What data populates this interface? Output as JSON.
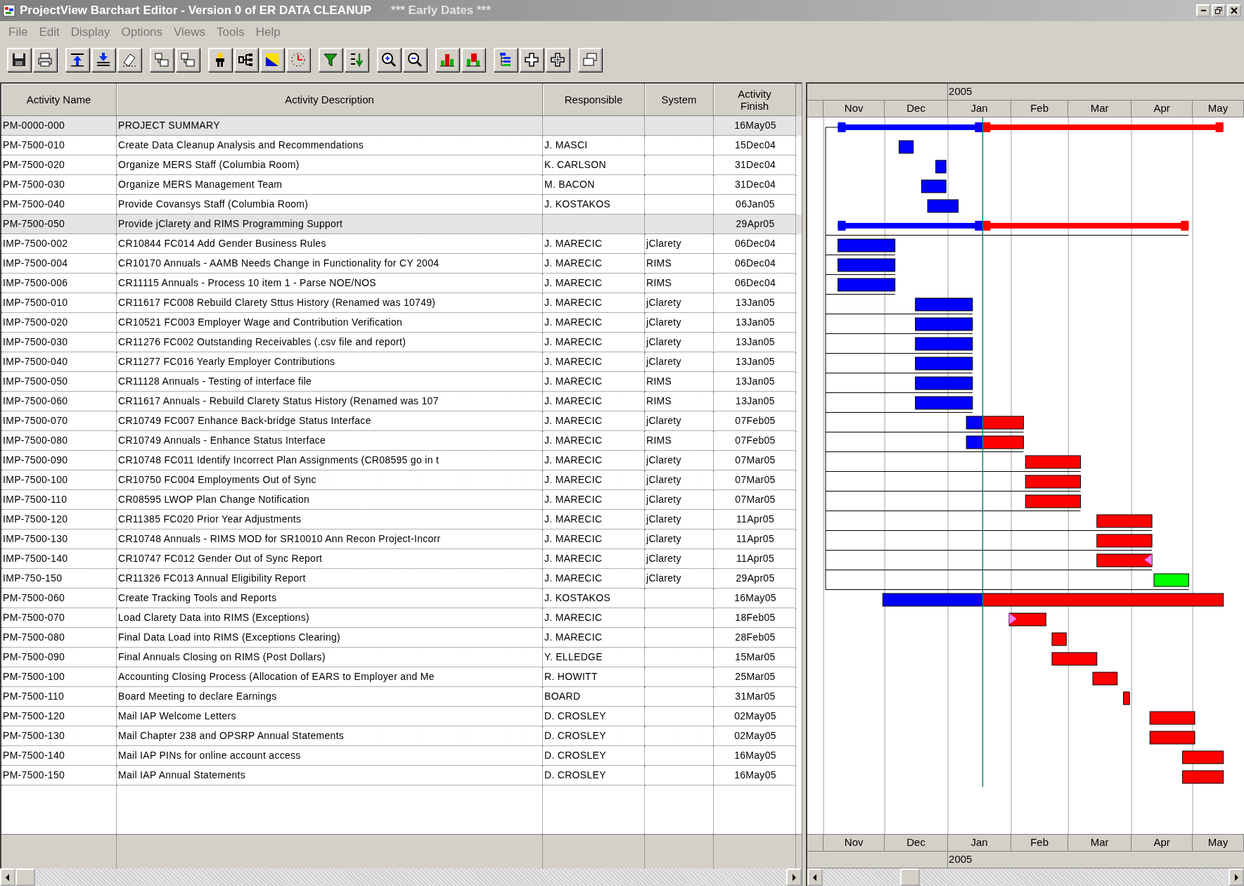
{
  "window": {
    "title": "ProjectView Barchart Editor - Version 0 of ER DATA CLEANUP",
    "subtitle": "*** Early Dates ***"
  },
  "menu": [
    "File",
    "Edit",
    "Display",
    "Options",
    "Views",
    "Tools",
    "Help"
  ],
  "table": {
    "columns": [
      "Activity Name",
      "Activity Description",
      "Responsible",
      "System",
      "Activity Finish"
    ],
    "rows": [
      {
        "name": "PM-0000-000",
        "description": "PROJECT SUMMARY",
        "finish": "16May05",
        "kind": "summary"
      },
      {
        "name": "PM-7500-010",
        "description": "Create Data Cleanup Analysis and Recommendations",
        "responsible": "J. MASCI",
        "finish": "15Dec04",
        "kind": "task"
      },
      {
        "name": "PM-7500-020",
        "description": "Organize MERS Staff (Columbia Room)",
        "responsible": "K. CARLSON",
        "finish": "31Dec04",
        "kind": "task"
      },
      {
        "name": "PM-7500-030",
        "description": "Organize MERS Management Team",
        "responsible": "M. BACON",
        "finish": "31Dec04",
        "kind": "task"
      },
      {
        "name": "PM-7500-040",
        "description": "Provide Covansys Staff (Columbia Room)",
        "responsible": "J. KOSTAKOS",
        "finish": "06Jan05",
        "kind": "task"
      },
      {
        "name": "PM-7500-050",
        "description": "Provide jClarety and RIMS Programming Support",
        "finish": "29Apr05",
        "kind": "summary"
      },
      {
        "name": "IMP-7500-002",
        "description": "CR10844 FC014 Add Gender Business Rules",
        "responsible": "J. MARECIC",
        "system": "jClarety",
        "finish": "06Dec04",
        "kind": "task"
      },
      {
        "name": "IMP-7500-004",
        "description": "CR10170 Annuals - AAMB Needs Change in Functionality for CY 2004",
        "responsible": "J. MARECIC",
        "system": "RIMS",
        "finish": "06Dec04",
        "kind": "task"
      },
      {
        "name": "IMP-7500-006",
        "description": "CR11115 Annuals - Process 10 item 1 - Parse NOE/NOS",
        "responsible": "J. MARECIC",
        "system": "RIMS",
        "finish": "06Dec04",
        "kind": "task"
      },
      {
        "name": "IMP-7500-010",
        "description": "CR11617 FC008 Rebuild Clarety Sttus History (Renamed was 10749)",
        "responsible": "J. MARECIC",
        "system": "jClarety",
        "finish": "13Jan05",
        "kind": "task"
      },
      {
        "name": "IMP-7500-020",
        "description": "CR10521 FC003 Employer Wage and Contribution Verification",
        "responsible": "J. MARECIC",
        "system": "jClarety",
        "finish": "13Jan05",
        "kind": "task"
      },
      {
        "name": "IMP-7500-030",
        "description": "CR11276 FC002 Outstanding Receivables (.csv file and report)",
        "responsible": "J. MARECIC",
        "system": "jClarety",
        "finish": "13Jan05",
        "kind": "task"
      },
      {
        "name": "IMP-7500-040",
        "description": "CR11277 FC016 Yearly Employer Contributions",
        "responsible": "J. MARECIC",
        "system": "jClarety",
        "finish": "13Jan05",
        "kind": "task"
      },
      {
        "name": "IMP-7500-050",
        "description": "CR11128 Annuals - Testing of interface file",
        "responsible": "J. MARECIC",
        "system": "RIMS",
        "finish": "13Jan05",
        "kind": "task"
      },
      {
        "name": "IMP-7500-060",
        "description": "CR11617 Annuals - Rebuild Clarety Status History (Renamed was 107",
        "responsible": "J. MARECIC",
        "system": "RIMS",
        "finish": "13Jan05",
        "kind": "task"
      },
      {
        "name": "IMP-7500-070",
        "description": "CR10749 FC007 Enhance Back-bridge Status Interface",
        "responsible": "J. MARECIC",
        "system": "jClarety",
        "finish": "07Feb05",
        "kind": "task"
      },
      {
        "name": "IMP-7500-080",
        "description": "CR10749 Annuals - Enhance Status Interface",
        "responsible": "J. MARECIC",
        "system": "RIMS",
        "finish": "07Feb05",
        "kind": "task"
      },
      {
        "name": "IMP-7500-090",
        "description": "CR10748 FC011 Identify Incorrect Plan Assignments (CR08595 go in t",
        "responsible": "J. MARECIC",
        "system": "jClarety",
        "finish": "07Mar05",
        "kind": "task"
      },
      {
        "name": "IMP-7500-100",
        "description": "CR10750 FC004 Employments Out of Sync",
        "responsible": "J. MARECIC",
        "system": "jClarety",
        "finish": "07Mar05",
        "kind": "task"
      },
      {
        "name": "IMP-7500-110",
        "description": "CR08595 LWOP Plan Change Notification",
        "responsible": "J. MARECIC",
        "system": "jClarety",
        "finish": "07Mar05",
        "kind": "task"
      },
      {
        "name": "IMP-7500-120",
        "description": "CR11385 FC020 Prior Year Adjustments",
        "responsible": "J. MARECIC",
        "system": "jClarety",
        "finish": "11Apr05",
        "kind": "task"
      },
      {
        "name": "IMP-7500-130",
        "description": "CR10748 Annuals - RIMS MOD for SR10010 Ann Recon Project-Incorr",
        "responsible": "J. MARECIC",
        "system": "jClarety",
        "finish": "11Apr05",
        "kind": "task"
      },
      {
        "name": "IMP-7500-140",
        "description": "CR10747 FC012 Gender Out of Sync Report",
        "responsible": "J. MARECIC",
        "system": "jClarety",
        "finish": "11Apr05",
        "kind": "task"
      },
      {
        "name": "IMP-750-150",
        "description": "CR11326 FC013 Annual Eligibility Report",
        "responsible": "J. MARECIC",
        "system": "jClarety",
        "finish": "29Apr05",
        "kind": "task"
      },
      {
        "name": "PM-7500-060",
        "description": "Create Tracking Tools and Reports",
        "responsible": "J. KOSTAKOS",
        "finish": "16May05",
        "kind": "task"
      },
      {
        "name": "PM-7500-070",
        "description": "Load Clarety Data into RIMS (Exceptions)",
        "responsible": "J. MARECIC",
        "finish": "18Feb05",
        "kind": "task"
      },
      {
        "name": "PM-7500-080",
        "description": "Final Data Load into RIMS (Exceptions Clearing)",
        "responsible": "J. MARECIC",
        "finish": "28Feb05",
        "kind": "task"
      },
      {
        "name": "PM-7500-090",
        "description": "Final Annuals Closing on RIMS (Post Dollars)",
        "responsible": "Y. ELLEDGE",
        "finish": "15Mar05",
        "kind": "task"
      },
      {
        "name": "PM-7500-100",
        "description": "Accounting Closing Process (Allocation of EARS to Employer and Me",
        "responsible": "R. HOWITT",
        "finish": "25Mar05",
        "kind": "task"
      },
      {
        "name": "PM-7500-110",
        "description": "Board Meeting to declare Earnings",
        "responsible": "BOARD",
        "finish": "31Mar05",
        "kind": "task"
      },
      {
        "name": "PM-7500-120",
        "description": "Mail IAP Welcome Letters",
        "responsible": "D. CROSLEY",
        "finish": "02May05",
        "kind": "task"
      },
      {
        "name": "PM-7500-130",
        "description": "Mail Chapter 238 and OPSRP Annual Statements",
        "responsible": "D. CROSLEY",
        "finish": "02May05",
        "kind": "task"
      },
      {
        "name": "PM-7500-140",
        "description": "Mail IAP PINs for online account access",
        "responsible": "D. CROSLEY",
        "finish": "16May05",
        "kind": "task"
      },
      {
        "name": "PM-7500-150",
        "description": "Mail IAP Annual Statements",
        "responsible": "D. CROSLEY",
        "finish": "16May05",
        "kind": "task"
      }
    ]
  },
  "gantt": {
    "year": "2005",
    "months": [
      "Nov",
      "Dec",
      "Jan",
      "Feb",
      "Mar",
      "Apr",
      "May"
    ],
    "footer_months": [
      "Nov",
      "Dec",
      "Jan",
      "Feb",
      "Mar",
      "Apr",
      "May"
    ],
    "footer_year": "2005"
  }
}
